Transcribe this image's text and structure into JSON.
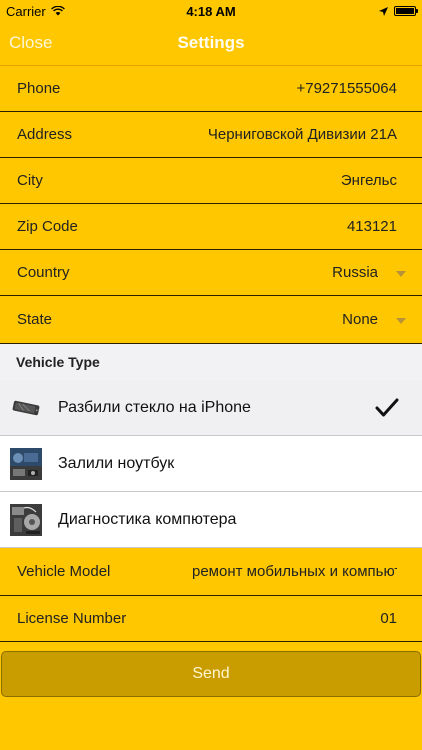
{
  "status_bar": {
    "carrier": "Carrier",
    "time": "4:18 AM"
  },
  "nav": {
    "close_label": "Close",
    "title": "Settings"
  },
  "form": {
    "phone": {
      "label": "Phone",
      "value": "+79271555064"
    },
    "address": {
      "label": "Address",
      "value": "Черниговской Дивизии 21А"
    },
    "city": {
      "label": "City",
      "value": "Энгельс"
    },
    "zip": {
      "label": "Zip Code",
      "value": "413121"
    },
    "country": {
      "label": "Country",
      "value": "Russia"
    },
    "state": {
      "label": "State",
      "value": "None"
    }
  },
  "vehicle_type": {
    "header": "Vehicle Type",
    "items": [
      {
        "label": "Разбили стекло на iPhone",
        "selected": true,
        "icon": "phone-icon"
      },
      {
        "label": "Залили ноутбук",
        "selected": false,
        "icon": "laptop-icon"
      },
      {
        "label": "Диагностика компютера",
        "selected": false,
        "icon": "computer-parts-icon"
      }
    ]
  },
  "vehicle_model": {
    "label": "Vehicle Model",
    "value": "ремонт мобильных и компьютеров"
  },
  "license": {
    "label": "License Number",
    "value": "01"
  },
  "send_label": "Send",
  "colors": {
    "background": "#FFC700",
    "button": "#C99D00",
    "section_header": "#F2F2F4"
  }
}
